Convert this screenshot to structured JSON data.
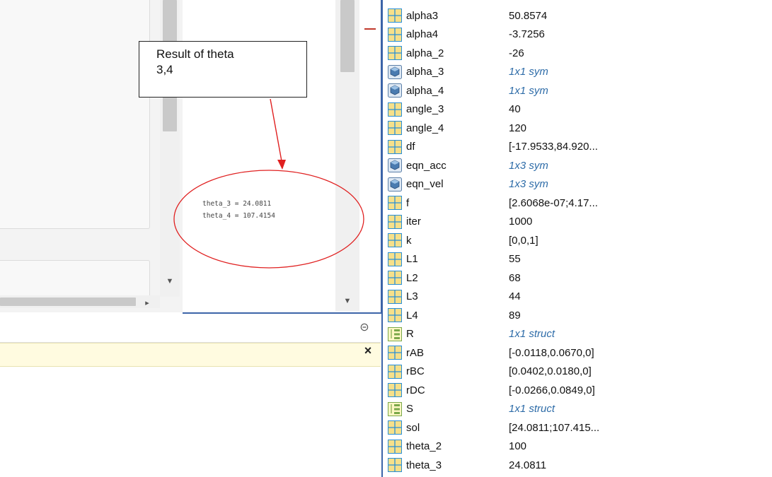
{
  "annotation": {
    "text_line1": "Result of theta",
    "text_line2": "3,4"
  },
  "command_window": {
    "output_lines": [
      "theta_3 = 24.0811",
      "theta_4 = 107.4154"
    ]
  },
  "message_bar": {
    "close_glyph": "×"
  },
  "toolbar": {
    "options_glyph": "⊝"
  },
  "workspace": {
    "rows": [
      {
        "name": "alpha3",
        "value": "50.8574",
        "type": "matrix",
        "italic": false
      },
      {
        "name": "alpha4",
        "value": "-3.7256",
        "type": "matrix",
        "italic": false
      },
      {
        "name": "alpha_2",
        "value": "-26",
        "type": "matrix",
        "italic": false
      },
      {
        "name": "alpha_3",
        "value": "1x1 sym",
        "type": "sym",
        "italic": true
      },
      {
        "name": "alpha_4",
        "value": "1x1 sym",
        "type": "sym",
        "italic": true
      },
      {
        "name": "angle_3",
        "value": "40",
        "type": "matrix",
        "italic": false
      },
      {
        "name": "angle_4",
        "value": "120",
        "type": "matrix",
        "italic": false
      },
      {
        "name": "df",
        "value": "[-17.9533,84.920...",
        "type": "matrix",
        "italic": false
      },
      {
        "name": "eqn_acc",
        "value": "1x3 sym",
        "type": "sym",
        "italic": true
      },
      {
        "name": "eqn_vel",
        "value": "1x3 sym",
        "type": "sym",
        "italic": true
      },
      {
        "name": "f",
        "value": "[2.6068e-07;4.17...",
        "type": "matrix",
        "italic": false
      },
      {
        "name": "iter",
        "value": "1000",
        "type": "matrix",
        "italic": false
      },
      {
        "name": "k",
        "value": "[0,0,1]",
        "type": "matrix",
        "italic": false
      },
      {
        "name": "L1",
        "value": "55",
        "type": "matrix",
        "italic": false
      },
      {
        "name": "L2",
        "value": "68",
        "type": "matrix",
        "italic": false
      },
      {
        "name": "L3",
        "value": "44",
        "type": "matrix",
        "italic": false
      },
      {
        "name": "L4",
        "value": "89",
        "type": "matrix",
        "italic": false
      },
      {
        "name": "R",
        "value": "1x1 struct",
        "type": "struct",
        "italic": true
      },
      {
        "name": "rAB",
        "value": "[-0.0118,0.0670,0]",
        "type": "matrix",
        "italic": false
      },
      {
        "name": "rBC",
        "value": "[0.0402,0.0180,0]",
        "type": "matrix",
        "italic": false
      },
      {
        "name": "rDC",
        "value": "[-0.0266,0.0849,0]",
        "type": "matrix",
        "italic": false
      },
      {
        "name": "S",
        "value": "1x1 struct",
        "type": "struct",
        "italic": true
      },
      {
        "name": "sol",
        "value": "[24.0811;107.415...",
        "type": "matrix",
        "italic": false
      },
      {
        "name": "theta_2",
        "value": "100",
        "type": "matrix",
        "italic": false
      },
      {
        "name": "theta_3",
        "value": "24.0811",
        "type": "matrix",
        "italic": false
      }
    ]
  },
  "colors": {
    "accent_border": "#3c64a8",
    "annotation_red": "#e02020",
    "sym_text": "#2e6ca8",
    "matrix_icon_fill": "#f6e08a",
    "matrix_icon_grid": "#2a8fd6",
    "message_bar_bg": "#fffbe0"
  }
}
